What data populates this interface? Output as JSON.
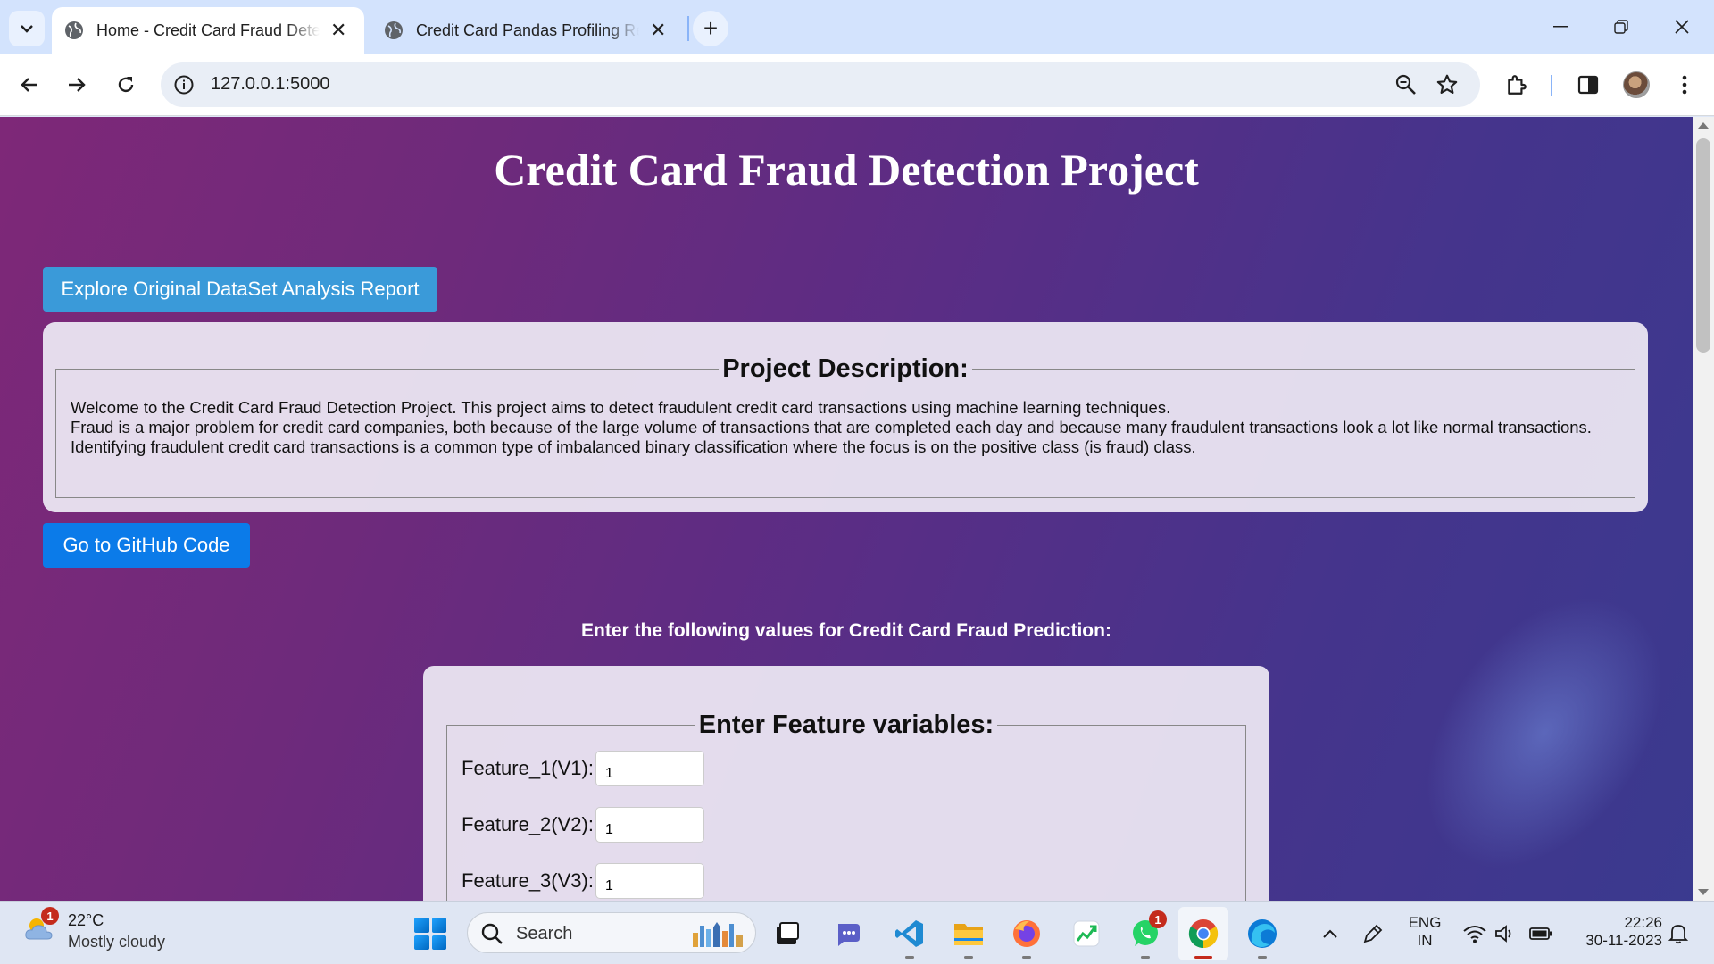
{
  "browser": {
    "tabs": [
      {
        "title": "Home - Credit Card Fraud Detection",
        "active": true
      },
      {
        "title": "Credit Card Pandas Profiling Report",
        "active": false
      }
    ],
    "url": "127.0.0.1:5000"
  },
  "page": {
    "title": "Credit Card Fraud Detection Project",
    "explore_button": "Explore Original DataSet Analysis Report",
    "description": {
      "legend": "Project Description:",
      "lines": [
        "Welcome to the Credit Card Fraud Detection Project. This project aims to detect fraudulent credit card transactions using machine learning techniques.",
        "Fraud is a major problem for credit card companies, both because of the large volume of transactions that are completed each day and because many fraudulent transactions look a lot like normal transactions.",
        "Identifying fraudulent credit card transactions is a common type of imbalanced binary classification where the focus is on the positive class (is fraud) class."
      ]
    },
    "github_button": "Go to GitHub Code",
    "form_prompt": "Enter the following values for Credit Card Fraud Prediction:",
    "form": {
      "legend": "Enter Feature variables:",
      "fields": [
        {
          "label": "Feature_1(V1):",
          "value": "1"
        },
        {
          "label": "Feature_2(V2):",
          "value": "1"
        },
        {
          "label": "Feature_3(V3):",
          "value": "1"
        }
      ]
    }
  },
  "taskbar": {
    "weather": {
      "temp": "22°C",
      "desc": "Mostly cloudy",
      "badge": "1"
    },
    "search_label": "Search",
    "whatsapp_badge": "1",
    "language": {
      "line1": "ENG",
      "line2": "IN"
    },
    "time": "22:26",
    "date": "30-11-2023"
  },
  "colors": {
    "explore_button": "#3a9ad9",
    "github_button": "#0b7be9",
    "page_gradient_start": "#7e2878",
    "page_gradient_end": "#3a3a8f"
  }
}
